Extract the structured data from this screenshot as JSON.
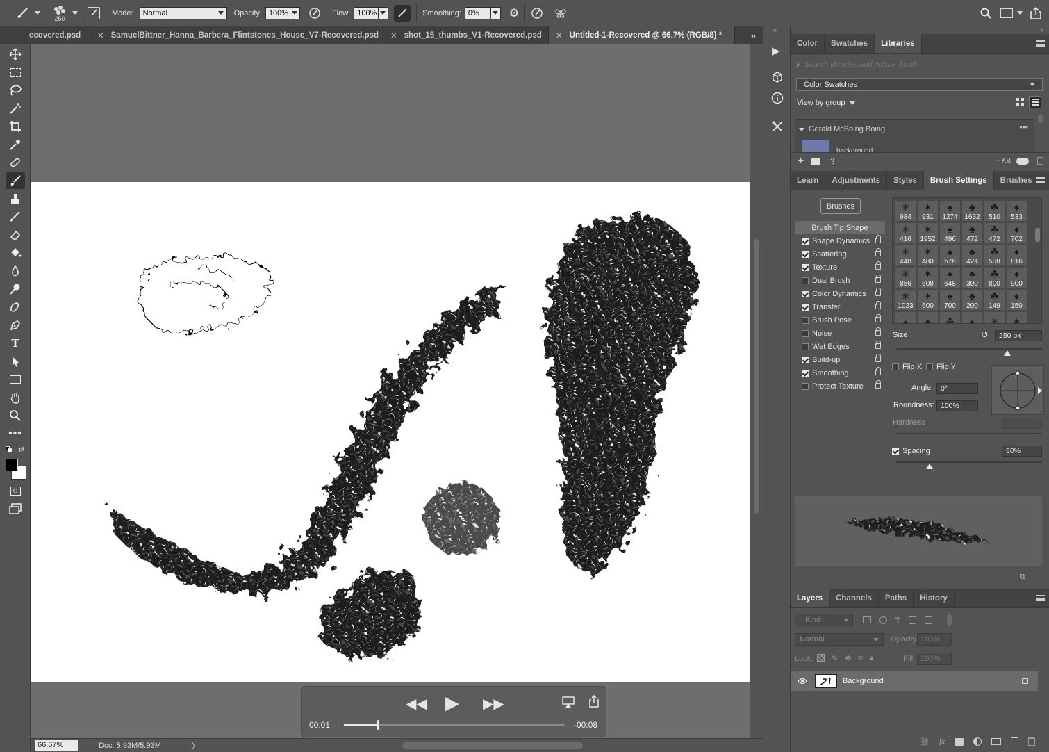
{
  "app": {
    "accent": "#1473e6"
  },
  "options_bar": {
    "brush_size": "250",
    "mode_label": "Mode:",
    "mode_value": "Normal",
    "opacity_label": "Opacity:",
    "opacity_value": "100%",
    "flow_label": "Flow:",
    "flow_value": "100%",
    "smoothing_label": "Smoothing:",
    "smoothing_value": "0%"
  },
  "tabs": [
    {
      "label": "ecovered.psd"
    },
    {
      "label": "SamuelBittner_Hanna_Barbera_Flintstones_House_V7-Recovered.psd"
    },
    {
      "label": "shot_15_thumbs_V1-Recovered.psd"
    },
    {
      "label": "Untitled-1-Recovered @ 66.7% (RGB/8) *"
    }
  ],
  "status": {
    "zoom": "66.67%",
    "doc": "Doc: 5.93M/5.93M"
  },
  "player": {
    "elapsed": "00:01",
    "remaining": "-00:08",
    "progress": 0.15
  },
  "libraries_panel": {
    "tabs": [
      "Color",
      "Swatches",
      "Libraries"
    ],
    "search_placeholder": "Search libraries and Adobe Stock",
    "library_select": "Color Swatches",
    "view_by": "View by group",
    "group_name": "Gerald McBoing Boing",
    "item_label": "background",
    "swatch_color": "#6f7aaa",
    "storage": "-- KB"
  },
  "brush_panel": {
    "tabs": [
      "Learn",
      "Adjustments",
      "Styles",
      "Brush Settings",
      "Brushes"
    ],
    "brushes_button": "Brushes",
    "tip_shape_label": "Brush Tip Shape",
    "options": [
      {
        "label": "Shape Dynamics",
        "checked": true
      },
      {
        "label": "Scattering",
        "checked": true
      },
      {
        "label": "Texture",
        "checked": true
      },
      {
        "label": "Dual Brush",
        "checked": false
      },
      {
        "label": "Color Dynamics",
        "checked": true
      },
      {
        "label": "Transfer",
        "checked": true
      },
      {
        "label": "Brush Pose",
        "checked": false
      },
      {
        "label": "Noise",
        "checked": false
      },
      {
        "label": "Wet Edges",
        "checked": false
      },
      {
        "label": "Build-up",
        "checked": true
      },
      {
        "label": "Smoothing",
        "checked": true
      },
      {
        "label": "Protect Texture",
        "checked": false
      }
    ],
    "tips": [
      "984",
      "931",
      "1274",
      "1632",
      "510",
      "533",
      "416",
      "1952",
      "496",
      "472",
      "472",
      "702",
      "448",
      "480",
      "576",
      "421",
      "538",
      "816",
      "856",
      "608",
      "648",
      "300",
      "800",
      "900",
      "1023",
      "600",
      "700",
      "200",
      "149",
      "150"
    ],
    "size_label": "Size",
    "size_value": "250 px",
    "flip_x": "Flip X",
    "flip_y": "Flip Y",
    "angle_label": "Angle:",
    "angle_value": "0°",
    "roundness_label": "Roundness:",
    "roundness_value": "100%",
    "hardness_label": "Hardness",
    "spacing_label": "Spacing",
    "spacing_value": "50%"
  },
  "layers_panel": {
    "tabs": [
      "Layers",
      "Channels",
      "Paths",
      "History"
    ],
    "kind_label": "Kind",
    "blend_mode": "Normal",
    "opacity_label": "Opacity:",
    "opacity_value": "100%",
    "lock_label": "Lock:",
    "fill_label": "Fill:",
    "fill_value": "100%",
    "layer_name": "Background"
  }
}
